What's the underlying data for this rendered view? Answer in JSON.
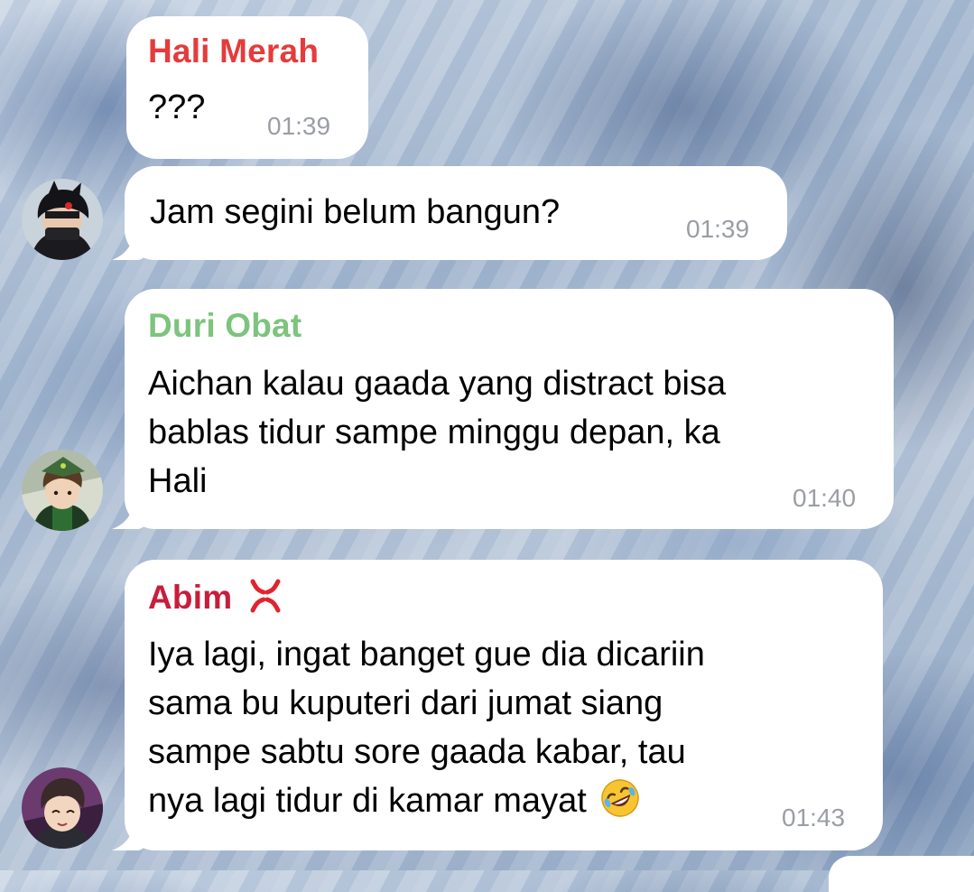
{
  "messages": [
    {
      "sender": "Hali Merah",
      "sender_color": "#e53b3b",
      "text": "???",
      "time": "01:39"
    },
    {
      "sender": "",
      "text": "Jam segini belum bangun?",
      "time": "01:39",
      "avatar": "avatar-hali-merah"
    },
    {
      "sender": "Duri Obat",
      "sender_color": "#7dc47c",
      "lines": [
        "Aichan kalau gaada yang distract bisa",
        "bablas tidur sampe minggu depan, ka",
        "Hali"
      ],
      "time": "01:40",
      "avatar": "avatar-duri-obat"
    },
    {
      "sender": "Abim",
      "sender_color": "#c81d3c",
      "sender_emoji": "anger-symbol-icon",
      "lines": [
        "Iya lagi, ingat banget gue dia dicariin",
        "sama bu kuputeri dari jumat siang",
        "sampe sabtu sore gaada kabar, tau",
        "nya lagi tidur di kamar mayat"
      ],
      "trailing_emoji": "rolling-on-floor-laughing-icon",
      "time": "01:43",
      "avatar": "avatar-abim"
    }
  ]
}
